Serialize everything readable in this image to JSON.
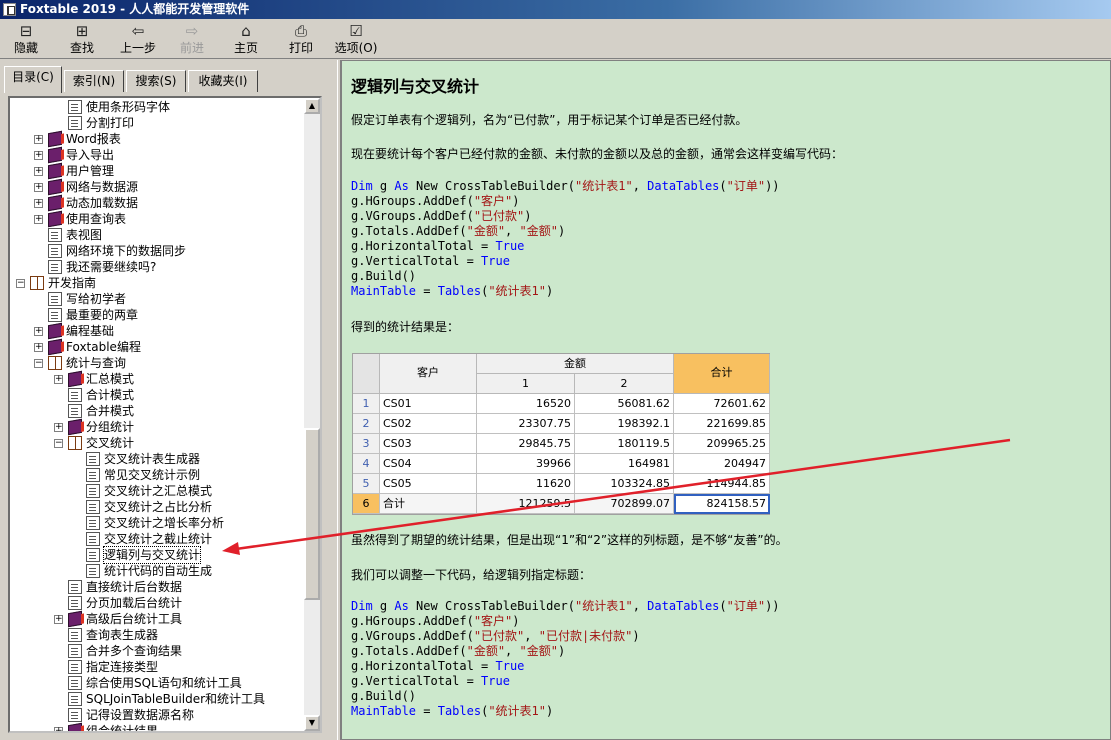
{
  "window": {
    "title": "Foxtable 2019 - 人人都能开发管理软件"
  },
  "toolbar": {
    "hide": "隐藏",
    "find": "查找",
    "back": "上一步",
    "forward": "前进",
    "home": "主页",
    "print": "打印",
    "options": "选项(O)"
  },
  "tabs": {
    "contents": "目录(C)",
    "index": "索引(N)",
    "search": "搜索(S)",
    "favorites": "收藏夹(I)"
  },
  "tree": [
    {
      "label": "使用条形码字体",
      "icon": "page",
      "level": 3
    },
    {
      "label": "分割打印",
      "icon": "page",
      "level": 3
    },
    {
      "label": "Word报表",
      "icon": "book",
      "level": 2,
      "exp": "+"
    },
    {
      "label": "导入导出",
      "icon": "book",
      "level": 2,
      "exp": "+"
    },
    {
      "label": "用户管理",
      "icon": "book",
      "level": 2,
      "exp": "+"
    },
    {
      "label": "网络与数据源",
      "icon": "book",
      "level": 2,
      "exp": "+"
    },
    {
      "label": "动态加载数据",
      "icon": "book",
      "level": 2,
      "exp": "+"
    },
    {
      "label": "使用查询表",
      "icon": "book",
      "level": 2,
      "exp": "+"
    },
    {
      "label": "表视图",
      "icon": "page",
      "level": 2
    },
    {
      "label": "网络环境下的数据同步",
      "icon": "page",
      "level": 2
    },
    {
      "label": "我还需要继续吗?",
      "icon": "page",
      "level": 2
    },
    {
      "label": "开发指南",
      "icon": "openbook",
      "level": 1,
      "exp": "-"
    },
    {
      "label": "写给初学者",
      "icon": "page",
      "level": 2
    },
    {
      "label": "最重要的两章",
      "icon": "page",
      "level": 2
    },
    {
      "label": "编程基础",
      "icon": "book",
      "level": 2,
      "exp": "+"
    },
    {
      "label": "Foxtable编程",
      "icon": "book",
      "level": 2,
      "exp": "+"
    },
    {
      "label": "统计与查询",
      "icon": "openbook",
      "level": 2,
      "exp": "-"
    },
    {
      "label": "汇总模式",
      "icon": "book",
      "level": 3,
      "exp": "+"
    },
    {
      "label": "合计模式",
      "icon": "page",
      "level": 3
    },
    {
      "label": "合并模式",
      "icon": "page",
      "level": 3
    },
    {
      "label": "分组统计",
      "icon": "book",
      "level": 3,
      "exp": "+"
    },
    {
      "label": "交叉统计",
      "icon": "openbook",
      "level": 3,
      "exp": "-"
    },
    {
      "label": "交叉统计表生成器",
      "icon": "page",
      "level": 4
    },
    {
      "label": "常见交叉统计示例",
      "icon": "page",
      "level": 4
    },
    {
      "label": "交叉统计之汇总模式",
      "icon": "page",
      "level": 4
    },
    {
      "label": "交叉统计之占比分析",
      "icon": "page",
      "level": 4
    },
    {
      "label": "交叉统计之增长率分析",
      "icon": "page",
      "level": 4
    },
    {
      "label": "交叉统计之截止统计",
      "icon": "page",
      "level": 4
    },
    {
      "label": "逻辑列与交叉统计",
      "icon": "page",
      "level": 4,
      "selected": true
    },
    {
      "label": "统计代码的自动生成",
      "icon": "page",
      "level": 4
    },
    {
      "label": "直接统计后台数据",
      "icon": "page",
      "level": 3
    },
    {
      "label": "分页加载后台统计",
      "icon": "page",
      "level": 3
    },
    {
      "label": "高级后台统计工具",
      "icon": "book",
      "level": 3,
      "exp": "+"
    },
    {
      "label": "查询表生成器",
      "icon": "page",
      "level": 3
    },
    {
      "label": "合并多个查询结果",
      "icon": "page",
      "level": 3
    },
    {
      "label": "指定连接类型",
      "icon": "page",
      "level": 3
    },
    {
      "label": "综合使用SQL语句和统计工具",
      "icon": "page",
      "level": 3
    },
    {
      "label": "SQLJoinTableBuilder和统计工具",
      "icon": "page",
      "level": 3
    },
    {
      "label": "记得设置数据源名称",
      "icon": "page",
      "level": 3
    },
    {
      "label": "组合统计结果",
      "icon": "book",
      "level": 3,
      "exp": "+"
    }
  ],
  "content": {
    "title": "逻辑列与交叉统计",
    "p1": "假定订单表有个逻辑列，名为“已付款”，用于标记某个订单是否已经付款。",
    "p2": "现在要统计每个客户已经付款的金额、未付款的金额以及总的金额，通常会这样变编写代码：",
    "p3": "得到的统计结果是：",
    "p4": "虽然得到了期望的统计结果，但是出现“1”和“2”这样的列标题，是不够“友善”的。",
    "p5": "我们可以调整一下代码，给逻辑列指定标题：",
    "code1": [
      [
        [
          "kw",
          "Dim"
        ],
        [
          "t",
          " g "
        ],
        [
          "kw",
          "As"
        ],
        [
          "t",
          " New CrossTableBuilder("
        ],
        [
          "str",
          "\"统计表1\""
        ],
        [
          "t",
          ", "
        ],
        [
          "kw",
          "DataTables"
        ],
        [
          "t",
          "("
        ],
        [
          "str",
          "\"订单\""
        ],
        [
          "t",
          "))"
        ]
      ],
      [
        [
          "t",
          "g.HGroups.AddDef("
        ],
        [
          "str",
          "\"客户\""
        ],
        [
          "t",
          ")"
        ]
      ],
      [
        [
          "t",
          "g.VGroups.AddDef("
        ],
        [
          "str",
          "\"已付款\""
        ],
        [
          "t",
          ")"
        ]
      ],
      [
        [
          "t",
          "g.Totals.AddDef("
        ],
        [
          "str",
          "\"金额\""
        ],
        [
          "t",
          ", "
        ],
        [
          "str",
          "\"金额\""
        ],
        [
          "t",
          ")"
        ]
      ],
      [
        [
          "t",
          "g.HorizontalTotal = "
        ],
        [
          "kw",
          "True"
        ]
      ],
      [
        [
          "t",
          "g.VerticalTotal = "
        ],
        [
          "kw",
          "True"
        ]
      ],
      [
        [
          "t",
          "g.Build()"
        ]
      ],
      [
        [
          "kw",
          "MainTable"
        ],
        [
          "t",
          " = "
        ],
        [
          "kw",
          "Tables"
        ],
        [
          "t",
          "("
        ],
        [
          "str",
          "\"统计表1\""
        ],
        [
          "t",
          ")"
        ]
      ]
    ],
    "code2": [
      [
        [
          "kw",
          "Dim"
        ],
        [
          "t",
          " g "
        ],
        [
          "kw",
          "As"
        ],
        [
          "t",
          " New CrossTableBuilder("
        ],
        [
          "str",
          "\"统计表1\""
        ],
        [
          "t",
          ", "
        ],
        [
          "kw",
          "DataTables"
        ],
        [
          "t",
          "("
        ],
        [
          "str",
          "\"订单\""
        ],
        [
          "t",
          "))"
        ]
      ],
      [
        [
          "t",
          "g.HGroups.AddDef("
        ],
        [
          "str",
          "\"客户\""
        ],
        [
          "t",
          ")"
        ]
      ],
      [
        [
          "t",
          "g.VGroups.AddDef("
        ],
        [
          "str",
          "\"已付款\""
        ],
        [
          "t",
          ", "
        ],
        [
          "str",
          "\"已付款|未付款\""
        ],
        [
          "t",
          ")"
        ]
      ],
      [
        [
          "t",
          "g.Totals.AddDef("
        ],
        [
          "str",
          "\"金额\""
        ],
        [
          "t",
          ", "
        ],
        [
          "str",
          "\"金额\""
        ],
        [
          "t",
          ")"
        ]
      ],
      [
        [
          "t",
          "g.HorizontalTotal = "
        ],
        [
          "kw",
          "True"
        ]
      ],
      [
        [
          "t",
          "g.VerticalTotal = "
        ],
        [
          "kw",
          "True"
        ]
      ],
      [
        [
          "t",
          "g.Build()"
        ]
      ],
      [
        [
          "kw",
          "MainTable"
        ],
        [
          "t",
          " = "
        ],
        [
          "kw",
          "Tables"
        ],
        [
          "t",
          "("
        ],
        [
          "str",
          "\"统计表1\""
        ],
        [
          "t",
          ")"
        ]
      ]
    ]
  },
  "result_table": {
    "header_customer": "客户",
    "header_amount": "金额",
    "header_sub1": "1",
    "header_sub2": "2",
    "header_total": "合计",
    "rows": [
      {
        "no": "1",
        "customer": "CS01",
        "v1": "16520",
        "v2": "56081.62",
        "total": "72601.62"
      },
      {
        "no": "2",
        "customer": "CS02",
        "v1": "23307.75",
        "v2": "198392.1",
        "total": "221699.85"
      },
      {
        "no": "3",
        "customer": "CS03",
        "v1": "29845.75",
        "v2": "180119.5",
        "total": "209965.25"
      },
      {
        "no": "4",
        "customer": "CS04",
        "v1": "39966",
        "v2": "164981",
        "total": "204947"
      },
      {
        "no": "5",
        "customer": "CS05",
        "v1": "11620",
        "v2": "103324.85",
        "total": "114944.85"
      },
      {
        "no": "6",
        "customer": "合计",
        "v1": "121259.5",
        "v2": "702899.07",
        "total": "824158.57"
      }
    ]
  },
  "colors": {
    "content_bg": "#cce8cc",
    "arrow": "#e0202a",
    "total_header": "#f8c060"
  }
}
